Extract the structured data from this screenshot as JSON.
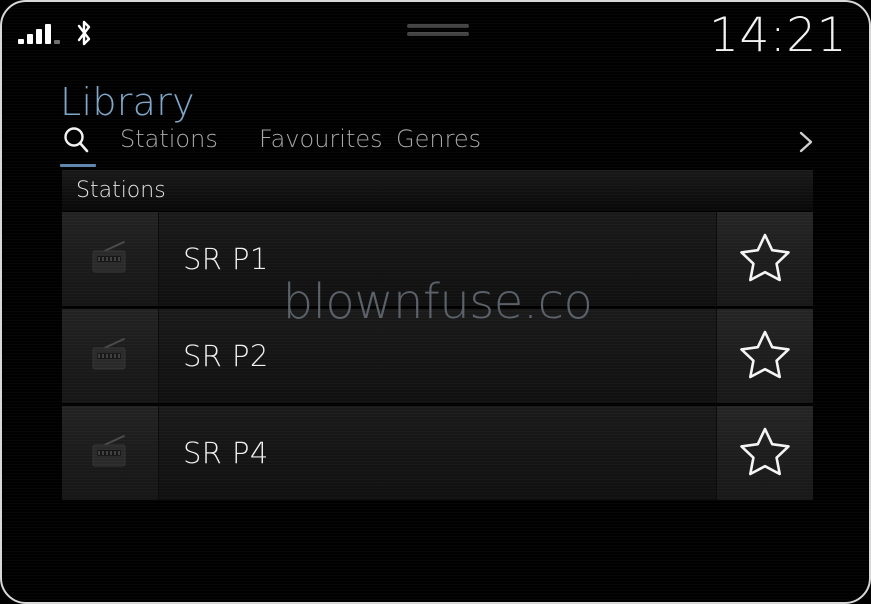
{
  "status_bar": {
    "signal_icon": "signal-bars-icon",
    "signal_bars": 4,
    "bluetooth_icon": "bluetooth-icon",
    "drag_handle_icon": "drag-handle-icon",
    "clock": "14:21"
  },
  "header": {
    "title": "Library"
  },
  "tabs": [
    {
      "id": "search",
      "label": "",
      "icon": "search-icon",
      "active": true
    },
    {
      "id": "stations",
      "label": "Stations",
      "icon": "",
      "active": false
    },
    {
      "id": "favourites",
      "label": "Favourites",
      "icon": "",
      "active": false
    },
    {
      "id": "genres",
      "label": "Genres",
      "icon": "",
      "active": false
    }
  ],
  "tab_next_arrow": "chevron-right-icon",
  "list": {
    "header_label": "Stations",
    "rows": [
      {
        "icon": "radio-icon",
        "title": "SR P1",
        "star": "star-outline-icon"
      },
      {
        "icon": "radio-icon",
        "title": "SR P2",
        "star": "star-outline-icon"
      },
      {
        "icon": "radio-icon",
        "title": "SR P4",
        "star": "star-outline-icon"
      }
    ]
  },
  "watermark": "blownfuse.co",
  "colors": {
    "accent_blue": "#7ea6c9",
    "tab_underline": "#5f86ad",
    "text_primary": "#f0f0f0",
    "text_muted": "#a8a8a8",
    "background": "#000000",
    "watermark": "#5a6068"
  }
}
